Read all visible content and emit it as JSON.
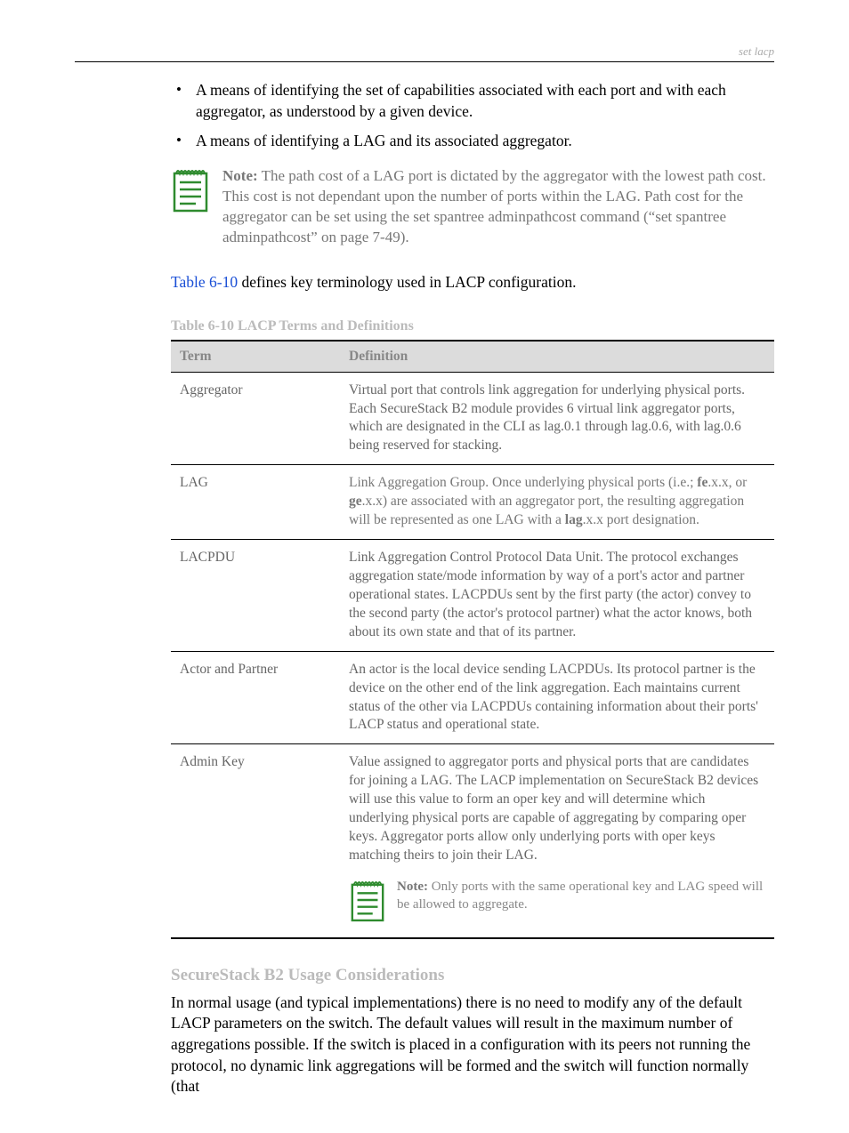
{
  "header": {
    "right": "set lacp"
  },
  "bullets": [
    "A means of identifying the set of capabilities associated with each port and with each aggregator, as understood by a given device.",
    "A means of identifying a LAG and its associated aggregator."
  ],
  "top_note": {
    "label": "Note:",
    "text": "The path cost of a LAG port is dictated by the aggregator with the lowest path cost. This cost is not dependant upon the number of ports within the LAG. Path cost for the aggregator can be set using the set spantree adminpathcost command (“set spantree adminpathcost” on page 7-49)."
  },
  "intro": {
    "link": "Table 6-10",
    "rest": " defines key terminology used in LACP configuration."
  },
  "table": {
    "caption": "Table 6-10    LACP Terms and Definitions",
    "headers": [
      "Term",
      "Definition"
    ],
    "rows": [
      {
        "term": "Aggregator",
        "def": "Virtual port that controls link aggregation for underlying physical ports. Each SecureStack B2 module provides 6 virtual link aggregator ports, which are designated in the CLI as lag.0.1 through lag.0.6, with lag.0.6 being reserved for stacking."
      },
      {
        "term": "LAG",
        "def": "Link Aggregation Group. Once underlying physical ports (i.e.; fe.x.x, or ge.x.x) are associated with an aggregator port, the resulting aggregation will be represented as one LAG with a lag.x.x port designation."
      },
      {
        "term": "LACPDU",
        "def": "Link Aggregation Control Protocol Data Unit. The protocol exchanges aggregation state/mode information by way of a port's actor and partner operational states. LACPDUs sent by the first party (the actor) convey to the second party (the actor's protocol partner) what the actor knows, both about its own state and that of its partner."
      },
      {
        "term": "Actor and Partner",
        "def": "An actor is the local device sending LACPDUs. Its protocol partner is the device on the other end of the link aggregation. Each maintains current status of the other via LACPDUs containing information about their ports' LACP status and operational state."
      },
      {
        "term": "Admin Key",
        "def_pre": "Value assigned to aggregator ports and physical ports that are candidates for joining a LAG. The LACP implementation on SecureStack B2 devices will use this value to form an oper key and will determine which underlying physical ports are capable of aggregating by comparing oper keys. Aggregator ports allow only underlying ports with oper keys matching theirs to join their LAG.",
        "note_label": "Note:",
        "note_text": "Only ports with the same operational key and LAG speed will be allowed to aggregate."
      }
    ]
  },
  "usage": {
    "heading": "SecureStack B2 Usage Considerations",
    "para": "In normal usage (and typical implementations) there is no need to modify any of the default LACP parameters on the switch. The default values will result in the maximum number of aggregations possible. If the switch is placed in a configuration with its peers not running the protocol, no dynamic link aggregations will be formed and the switch will function normally (that"
  }
}
